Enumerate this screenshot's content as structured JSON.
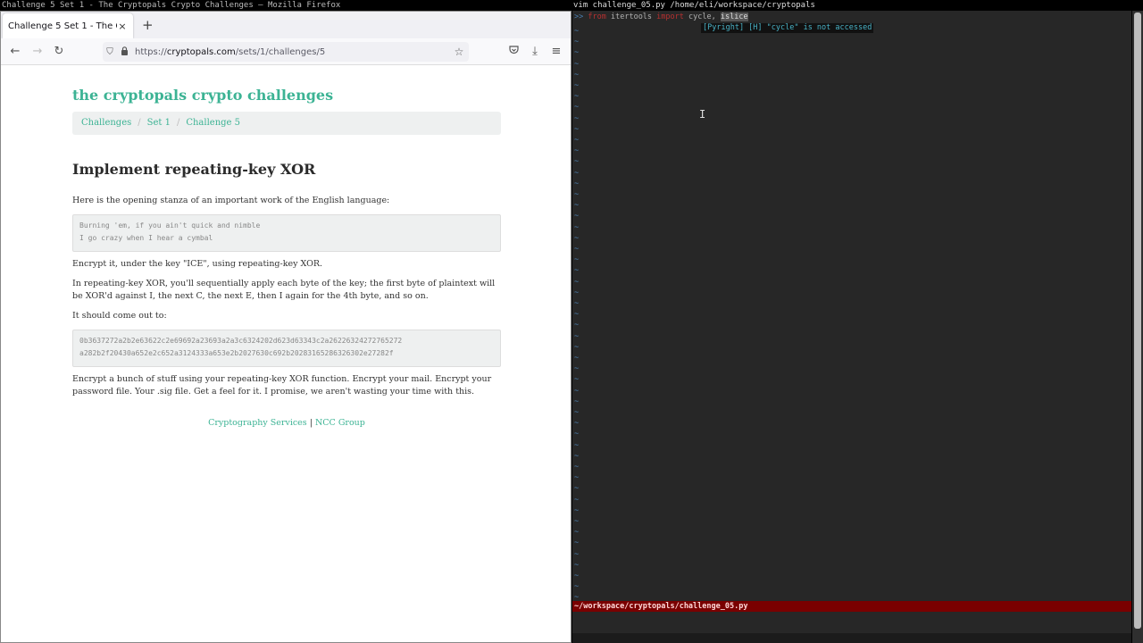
{
  "browser": {
    "window_title": "Challenge 5 Set 1 - The Cryptopals Crypto Challenges — Mozilla Firefox",
    "tab_label": "Challenge 5 Set 1 - The Cryptopals Crypto Challenges",
    "tab_close": "×",
    "new_tab": "+",
    "url_scheme": "https://",
    "url_host": "cryptopals.com",
    "url_path": "/sets/1/challenges/5",
    "icons": {
      "back": "←",
      "forward": "→",
      "reload": "↻",
      "shield": "⛉",
      "lock": "🔒",
      "bookmark": "☆",
      "pocket": "◡",
      "download": "⤓",
      "menu": "≡"
    }
  },
  "page": {
    "site_title": "the cryptopals crypto challenges",
    "breadcrumb": [
      {
        "label": "Challenges"
      },
      {
        "label": "Set 1"
      },
      {
        "label": "Challenge 5"
      }
    ],
    "breadcrumb_sep": "/",
    "heading": "Implement repeating-key XOR",
    "intro": "Here is the opening stanza of an important work of the English language:",
    "stanza": "Burning 'em, if you ain't quick and nimble\nI go crazy when I hear a cymbal",
    "encrypt_line": "Encrypt it, under the key \"ICE\", using repeating-key XOR.",
    "explanation": "In repeating-key XOR, you'll sequentially apply each byte of the key; the first byte of plaintext will be XOR'd against I, the next C, the next E, then I again for the 4th byte, and so on.",
    "come_out": "It should come out to:",
    "ciphertext": "0b3637272a2b2e63622c2e69692a23693a2a3c6324202d623d63343c2a26226324272765272\na282b2f20430a652e2c652a3124333a653e2b2027630c692b20283165286326302e27282f",
    "closing": "Encrypt a bunch of stuff using your repeating-key XOR function. Encrypt your mail. Encrypt your password file. Your .sig file. Get a feel for it. I promise, we aren't wasting your time with this.",
    "footer_link1": "Cryptography Services",
    "footer_sep": "|",
    "footer_link2": "NCC Group"
  },
  "terminal": {
    "window_title": "vim challenge_05.py /home/eli/workspace/cryptopals",
    "sign": ">>",
    "code_from": "from",
    "code_module": "itertools",
    "code_import": "import",
    "code_names": "cycle,",
    "code_highlighted": "islice",
    "diagnostic": "[Pyright] [H] \"cycle\" is not accessed",
    "tilde": "~",
    "status_path": "~/workspace/cryptopals/challenge_05.py",
    "cursor_glyph": "I"
  },
  "colors": {
    "accent": "#3cb394",
    "statusline": "#7a0000",
    "terminal_bg": "#272727"
  }
}
